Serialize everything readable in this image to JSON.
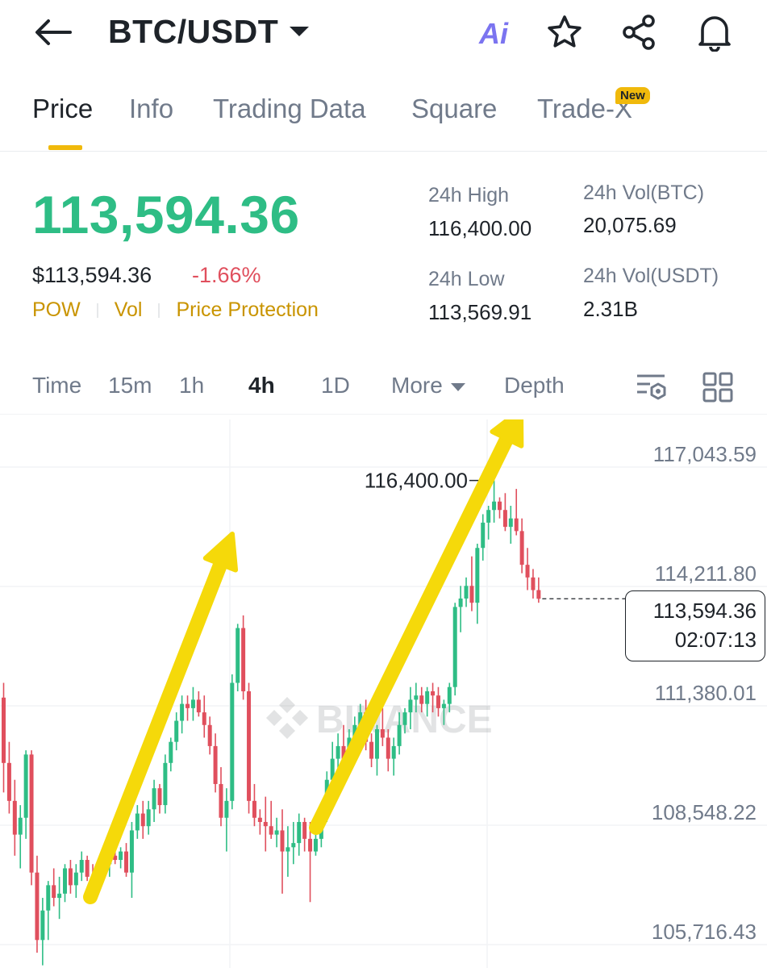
{
  "header": {
    "pair": "BTC/USDT",
    "ai_label": "Ai",
    "icons": [
      "back-arrow-icon",
      "caret-down-icon",
      "star-icon",
      "share-icon",
      "bell-icon"
    ]
  },
  "tabs": [
    {
      "label": "Price",
      "active": true
    },
    {
      "label": "Info"
    },
    {
      "label": "Trading Data"
    },
    {
      "label": "Square"
    },
    {
      "label": "Trade-X",
      "badge": "New"
    }
  ],
  "ticker": {
    "last_price": "113,594.36",
    "usd_price": "$113,594.36",
    "change_pct": "-1.66%",
    "tags": [
      "POW",
      "Vol",
      "Price Protection"
    ],
    "stats": {
      "high_label": "24h High",
      "high_value": "116,400.00",
      "low_label": "24h Low",
      "low_value": "113,569.91",
      "vol_btc_label": "24h Vol(BTC)",
      "vol_btc_value": "20,075.69",
      "vol_usdt_label": "24h Vol(USDT)",
      "vol_usdt_value": "2.31B"
    },
    "colors": {
      "up": "#2ebd85",
      "down": "#e04f5d",
      "accent": "#f0b90b",
      "tag": "#c99400"
    }
  },
  "intervals": {
    "items": [
      "Time",
      "15m",
      "1h",
      "4h",
      "1D",
      "More",
      "Depth"
    ],
    "active": "4h",
    "tool_icons": [
      "chart-settings-icon",
      "grid-layout-icon"
    ]
  },
  "chart": {
    "watermark": "BINANCE",
    "max_marker": "116,400.00",
    "current_price": "113,594.36",
    "countdown": "02:07:13"
  },
  "chart_data": {
    "type": "candlestick",
    "interval": "4h",
    "y_ticks": [
      {
        "value": 117043.59,
        "label": "117,043.59"
      },
      {
        "value": 114211.8,
        "label": "114,211.80"
      },
      {
        "value": 111380.01,
        "label": "111,380.01"
      },
      {
        "value": 108548.22,
        "label": "108,548.22"
      },
      {
        "value": 105716.43,
        "label": "105,716.43"
      }
    ],
    "ylim": [
      104700,
      117800
    ],
    "grid": true,
    "annotations": [
      "two yellow upward arrows drawn over the chart"
    ],
    "candles": [
      {
        "o": 111250,
        "h": 111600,
        "l": 109000,
        "c": 109700
      },
      {
        "o": 109700,
        "h": 110200,
        "l": 108500,
        "c": 108800
      },
      {
        "o": 108800,
        "h": 109300,
        "l": 107500,
        "c": 108000
      },
      {
        "o": 108000,
        "h": 108700,
        "l": 107200,
        "c": 108400
      },
      {
        "o": 108400,
        "h": 110000,
        "l": 107900,
        "c": 109900
      },
      {
        "o": 109900,
        "h": 110000,
        "l": 106800,
        "c": 107100
      },
      {
        "o": 107100,
        "h": 107500,
        "l": 105200,
        "c": 105500
      },
      {
        "o": 105500,
        "h": 106500,
        "l": 104900,
        "c": 106200
      },
      {
        "o": 106200,
        "h": 106900,
        "l": 105500,
        "c": 106800
      },
      {
        "o": 106800,
        "h": 107200,
        "l": 106300,
        "c": 106500
      },
      {
        "o": 106500,
        "h": 107000,
        "l": 106000,
        "c": 106600
      },
      {
        "o": 106600,
        "h": 107300,
        "l": 106400,
        "c": 107200
      },
      {
        "o": 107200,
        "h": 107400,
        "l": 106600,
        "c": 106800
      },
      {
        "o": 106800,
        "h": 107300,
        "l": 106500,
        "c": 107100
      },
      {
        "o": 107100,
        "h": 107600,
        "l": 106900,
        "c": 107400
      },
      {
        "o": 107400,
        "h": 107500,
        "l": 106900,
        "c": 107000
      },
      {
        "o": 107000,
        "h": 107300,
        "l": 106600,
        "c": 106900
      },
      {
        "o": 106900,
        "h": 107300,
        "l": 106800,
        "c": 107200
      },
      {
        "o": 107200,
        "h": 107400,
        "l": 107000,
        "c": 107300
      },
      {
        "o": 107300,
        "h": 107600,
        "l": 107000,
        "c": 107500
      },
      {
        "o": 107500,
        "h": 107700,
        "l": 107300,
        "c": 107400
      },
      {
        "o": 107400,
        "h": 107700,
        "l": 107200,
        "c": 107600
      },
      {
        "o": 107600,
        "h": 107800,
        "l": 107000,
        "c": 107100
      },
      {
        "o": 107100,
        "h": 108300,
        "l": 106500,
        "c": 108100
      },
      {
        "o": 108100,
        "h": 108700,
        "l": 107900,
        "c": 108500
      },
      {
        "o": 108500,
        "h": 108800,
        "l": 107900,
        "c": 108200
      },
      {
        "o": 108200,
        "h": 108800,
        "l": 108000,
        "c": 108600
      },
      {
        "o": 108600,
        "h": 109300,
        "l": 108300,
        "c": 109100
      },
      {
        "o": 109100,
        "h": 109200,
        "l": 108500,
        "c": 108700
      },
      {
        "o": 108700,
        "h": 109900,
        "l": 108500,
        "c": 109700
      },
      {
        "o": 109700,
        "h": 110300,
        "l": 109500,
        "c": 110200
      },
      {
        "o": 110200,
        "h": 110900,
        "l": 110000,
        "c": 110700
      },
      {
        "o": 110700,
        "h": 111300,
        "l": 110400,
        "c": 111100
      },
      {
        "o": 111100,
        "h": 111300,
        "l": 110700,
        "c": 111000
      },
      {
        "o": 111000,
        "h": 111500,
        "l": 110700,
        "c": 111200
      },
      {
        "o": 111200,
        "h": 111400,
        "l": 110800,
        "c": 110900
      },
      {
        "o": 110900,
        "h": 111300,
        "l": 110300,
        "c": 110600
      },
      {
        "o": 110600,
        "h": 110800,
        "l": 109900,
        "c": 110100
      },
      {
        "o": 110100,
        "h": 110400,
        "l": 109000,
        "c": 109200
      },
      {
        "o": 109200,
        "h": 109600,
        "l": 108200,
        "c": 108400
      },
      {
        "o": 108400,
        "h": 109100,
        "l": 107600,
        "c": 108800
      },
      {
        "o": 108800,
        "h": 111800,
        "l": 108600,
        "c": 111600
      },
      {
        "o": 111600,
        "h": 113000,
        "l": 111400,
        "c": 112900
      },
      {
        "o": 112900,
        "h": 113200,
        "l": 111200,
        "c": 111400
      },
      {
        "o": 111400,
        "h": 111600,
        "l": 108500,
        "c": 108800
      },
      {
        "o": 108800,
        "h": 109200,
        "l": 108200,
        "c": 108400
      },
      {
        "o": 108400,
        "h": 108600,
        "l": 108000,
        "c": 108300
      },
      {
        "o": 108300,
        "h": 108900,
        "l": 107600,
        "c": 108200
      },
      {
        "o": 108200,
        "h": 108800,
        "l": 107900,
        "c": 108000
      },
      {
        "o": 108000,
        "h": 108400,
        "l": 107700,
        "c": 108100
      },
      {
        "o": 108100,
        "h": 108600,
        "l": 106600,
        "c": 107600
      },
      {
        "o": 107600,
        "h": 108200,
        "l": 107000,
        "c": 107700
      },
      {
        "o": 107700,
        "h": 108300,
        "l": 107300,
        "c": 107800
      },
      {
        "o": 107800,
        "h": 108500,
        "l": 107500,
        "c": 108300
      },
      {
        "o": 108300,
        "h": 108400,
        "l": 107600,
        "c": 107900
      },
      {
        "o": 107900,
        "h": 108300,
        "l": 106400,
        "c": 107600
      },
      {
        "o": 107600,
        "h": 108000,
        "l": 107500,
        "c": 107900
      },
      {
        "o": 107900,
        "h": 108600,
        "l": 107700,
        "c": 108500
      },
      {
        "o": 108500,
        "h": 109500,
        "l": 108300,
        "c": 109300
      },
      {
        "o": 109300,
        "h": 110200,
        "l": 108800,
        "c": 109800
      },
      {
        "o": 109800,
        "h": 110400,
        "l": 109300,
        "c": 110100
      },
      {
        "o": 110100,
        "h": 110600,
        "l": 109600,
        "c": 109800
      },
      {
        "o": 109800,
        "h": 110500,
        "l": 109500,
        "c": 110300
      },
      {
        "o": 110300,
        "h": 110800,
        "l": 110100,
        "c": 110600
      },
      {
        "o": 110600,
        "h": 111100,
        "l": 110400,
        "c": 110900
      },
      {
        "o": 110900,
        "h": 111200,
        "l": 110000,
        "c": 110200
      },
      {
        "o": 110200,
        "h": 110400,
        "l": 109600,
        "c": 109800
      },
      {
        "o": 109800,
        "h": 110600,
        "l": 109400,
        "c": 110500
      },
      {
        "o": 110500,
        "h": 111000,
        "l": 110100,
        "c": 110300
      },
      {
        "o": 110300,
        "h": 110500,
        "l": 109500,
        "c": 109800
      },
      {
        "o": 109800,
        "h": 110300,
        "l": 109400,
        "c": 110100
      },
      {
        "o": 110100,
        "h": 110900,
        "l": 109900,
        "c": 110600
      },
      {
        "o": 110600,
        "h": 111000,
        "l": 110400,
        "c": 110900
      },
      {
        "o": 110900,
        "h": 111500,
        "l": 110500,
        "c": 111200
      },
      {
        "o": 111200,
        "h": 111600,
        "l": 110900,
        "c": 111300
      },
      {
        "o": 111300,
        "h": 111500,
        "l": 110900,
        "c": 111100
      },
      {
        "o": 111100,
        "h": 111500,
        "l": 110800,
        "c": 111400
      },
      {
        "o": 111400,
        "h": 111600,
        "l": 110900,
        "c": 111300
      },
      {
        "o": 111300,
        "h": 111500,
        "l": 110800,
        "c": 111000
      },
      {
        "o": 111000,
        "h": 111200,
        "l": 110600,
        "c": 111100
      },
      {
        "o": 111100,
        "h": 111600,
        "l": 110900,
        "c": 111500
      },
      {
        "o": 111500,
        "h": 113500,
        "l": 111300,
        "c": 113400
      },
      {
        "o": 113400,
        "h": 113900,
        "l": 112800,
        "c": 113600
      },
      {
        "o": 113600,
        "h": 114100,
        "l": 113400,
        "c": 113900
      },
      {
        "o": 113900,
        "h": 114600,
        "l": 113300,
        "c": 113500
      },
      {
        "o": 113500,
        "h": 114900,
        "l": 113000,
        "c": 114800
      },
      {
        "o": 114800,
        "h": 115600,
        "l": 114500,
        "c": 115400
      },
      {
        "o": 115400,
        "h": 115800,
        "l": 115000,
        "c": 115700
      },
      {
        "o": 115700,
        "h": 116400,
        "l": 115400,
        "c": 115900
      },
      {
        "o": 115900,
        "h": 116000,
        "l": 115500,
        "c": 115700
      },
      {
        "o": 115700,
        "h": 116100,
        "l": 115200,
        "c": 115300
      },
      {
        "o": 115300,
        "h": 115800,
        "l": 114900,
        "c": 115500
      },
      {
        "o": 115500,
        "h": 116200,
        "l": 115100,
        "c": 115200
      },
      {
        "o": 115200,
        "h": 115500,
        "l": 114200,
        "c": 114400
      },
      {
        "o": 114400,
        "h": 114800,
        "l": 113800,
        "c": 114100
      },
      {
        "o": 114100,
        "h": 114300,
        "l": 113600,
        "c": 113800
      },
      {
        "o": 113800,
        "h": 114100,
        "l": 113500,
        "c": 113594.36
      }
    ]
  }
}
